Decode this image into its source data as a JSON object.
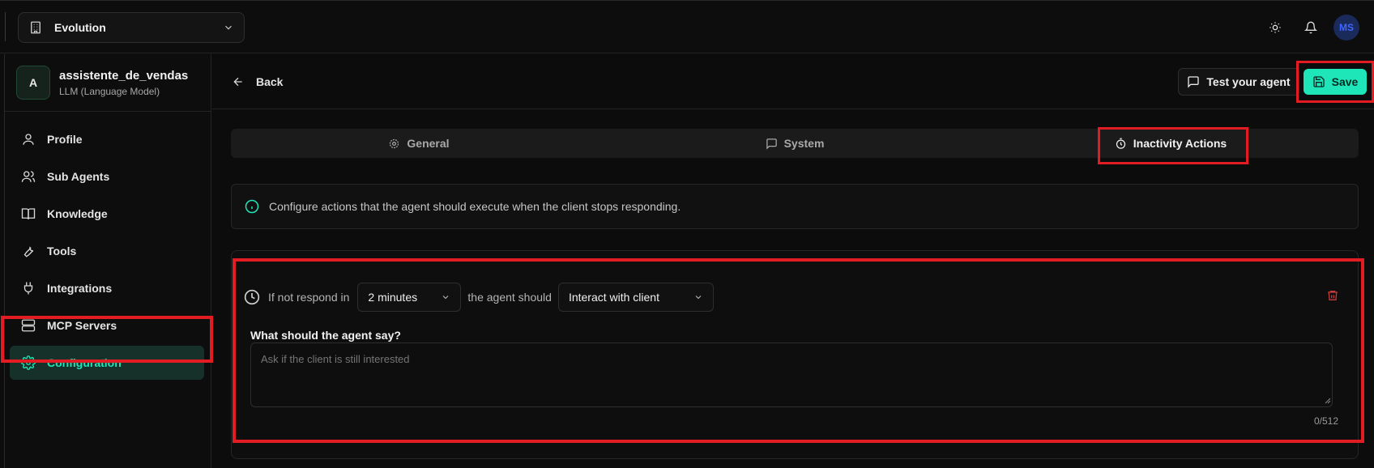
{
  "topbar": {
    "org_name": "Evolution",
    "icons": [
      "building-icon",
      "chevron-down-icon",
      "sun-icon",
      "bell-icon"
    ],
    "user_initials": "MS"
  },
  "sidebar": {
    "agent_initial": "A",
    "agent_name": "assistente_de_vendas",
    "agent_type": "LLM (Language Model)",
    "items": [
      {
        "label": "Profile",
        "icon": "user-icon"
      },
      {
        "label": "Sub Agents",
        "icon": "users-icon"
      },
      {
        "label": "Knowledge",
        "icon": "book-icon"
      },
      {
        "label": "Tools",
        "icon": "wrench-icon"
      },
      {
        "label": "Integrations",
        "icon": "plug-icon"
      },
      {
        "label": "MCP Servers",
        "icon": "server-icon"
      },
      {
        "label": "Configuration",
        "icon": "gear-icon",
        "active": true
      }
    ]
  },
  "header": {
    "back_label": "Back",
    "test_label": "Test your agent",
    "save_label": "Save"
  },
  "tabs": [
    {
      "label": "General",
      "icon": "gear-icon"
    },
    {
      "label": "System",
      "icon": "message-icon"
    },
    {
      "label": "Inactivity Actions",
      "icon": "timer-icon",
      "active": true
    }
  ],
  "info": {
    "text": "Configure actions that the agent should execute when the client stops responding."
  },
  "action": {
    "prefix": "If not respond in",
    "time_value": "2 minutes",
    "middle": "the agent should",
    "action_value": "Interact with client",
    "say_label": "What should the agent say?",
    "say_placeholder": "Ask if the client is still interested",
    "char_count": "0/512"
  },
  "colors": {
    "accent": "#1ee6b8",
    "highlight": "#e31b23",
    "danger": "#c43a3a"
  }
}
